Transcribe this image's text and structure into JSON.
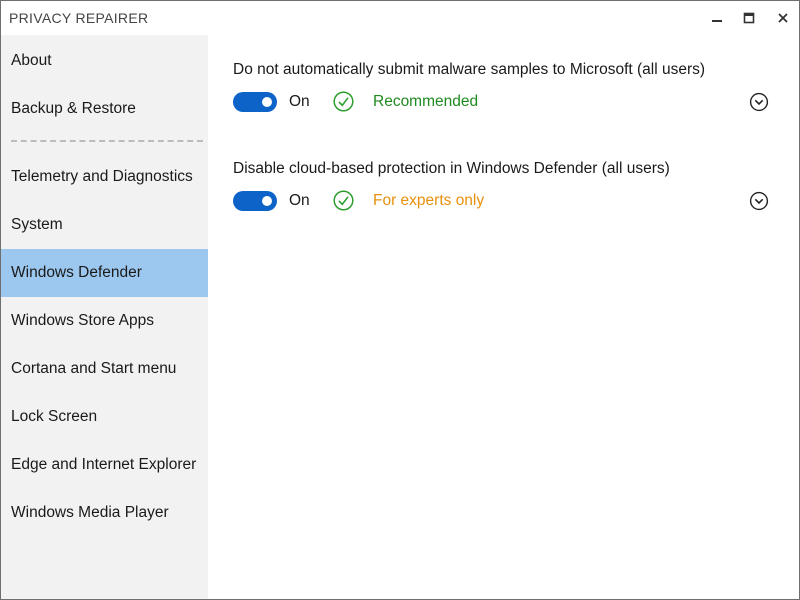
{
  "window": {
    "title": "PRIVACY REPAIRER"
  },
  "sidebar": {
    "items": [
      {
        "label": "About"
      },
      {
        "label": "Backup & Restore"
      },
      {
        "label": "Telemetry and Diagnostics"
      },
      {
        "label": "System"
      },
      {
        "label": "Windows Defender",
        "active": true
      },
      {
        "label": "Windows Store Apps"
      },
      {
        "label": "Cortana and Start menu"
      },
      {
        "label": "Lock Screen"
      },
      {
        "label": "Edge and Internet Explorer"
      },
      {
        "label": "Windows Media Player"
      }
    ]
  },
  "settings": [
    {
      "title": "Do not automatically submit malware samples to Microsoft (all users)",
      "toggle_label": "On",
      "toggle_on": true,
      "status": "Recommended",
      "status_color": "#1f8a1f"
    },
    {
      "title": "Disable cloud-based protection in Windows Defender (all users)",
      "toggle_label": "On",
      "toggle_on": true,
      "status": "For experts only",
      "status_color": "#e8900c"
    }
  ],
  "colors": {
    "accent": "#0e63c9",
    "nav_active": "#9cc7ef",
    "sidebar_bg": "#f2f2f2",
    "check_green": "#2e9e2e"
  },
  "icons": {
    "minimize": "minimize-icon",
    "maximize": "maximize-icon",
    "close": "close-icon",
    "check": "check-circle-icon",
    "expand": "chevron-down-circle-icon"
  }
}
